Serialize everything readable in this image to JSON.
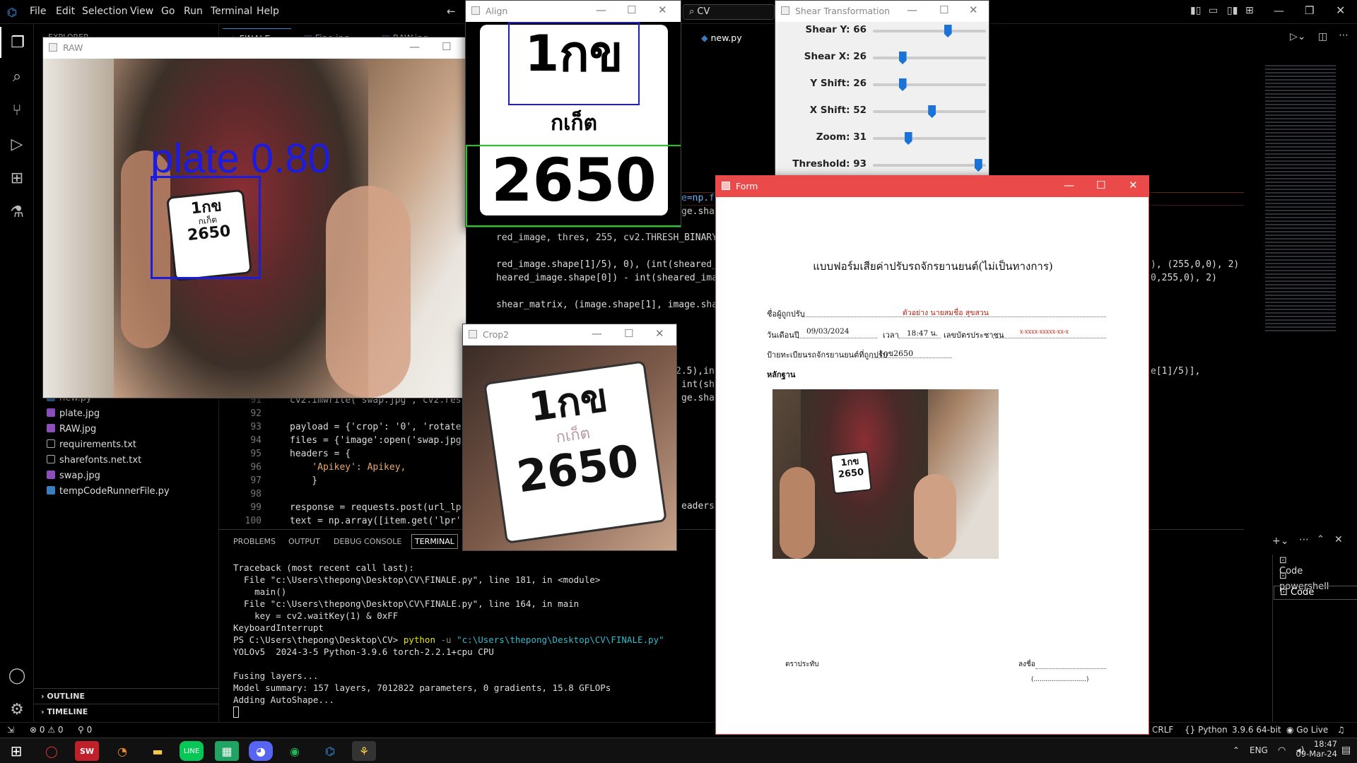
{
  "vscode": {
    "menu": [
      "File",
      "Edit",
      "Selection",
      "View",
      "Go",
      "Run",
      "Terminal",
      "Help"
    ],
    "search_text": "CV",
    "sidebar_title": "EXPLORER",
    "files": [
      "new.py",
      "plate.jpg",
      "RAW.jpg",
      "requirements.txt",
      "sharefonts.net.txt",
      "swap.jpg",
      "tempCodeRunnerFile.py"
    ],
    "outline_label": "OUTLINE",
    "timeline_label": "TIMELINE",
    "tabs": [
      "FINALE.py",
      "Fine.jpg",
      "RAW.jpg",
      "new.py"
    ],
    "line_numbers": [
      "91",
      "92",
      "93",
      "94",
      "95",
      "96",
      "97",
      "98",
      "99",
      "100"
    ],
    "code_lines": [
      "cv2.imwrite('swap.jpg', cv2.resi",
      "",
      "payload = {'crop': '0', 'rotate'",
      "files = {'image':open('swap.jpg'",
      "headers = {",
      "    'Apikey': Apikey,",
      "    }",
      "",
      "response = requests.post(url_lpr",
      "text = np.array([item.get('lpr')"
    ],
    "code_fragments": {
      "f1": "e=np.f",
      "f2": "ge.sha",
      "f3": "red_image, thres, 255, cv2.THRESH_BINARY)",
      "f4": "red_image.shape[1]/5), 0), (int(sheared_",
      "f5": "heared_image.shape[0]) - int(sheared_ima",
      "f6": "shear_matrix, (image.shape[1], image.sha",
      "f7": "2.5),in",
      "f8": "int(sh",
      "f9": "ge.sha",
      "f10": "eaders",
      "r1": "), (255,0,0), 2)",
      "r2": "0,255,0), 2)",
      "r3": "e[1]/5)],"
    },
    "panel_tabs": [
      "PROBLEMS",
      "OUTPUT",
      "DEBUG CONSOLE",
      "TERMINAL"
    ],
    "terminal_lines": [
      "Traceback (most recent call last):",
      "  File \"c:\\Users\\thepong\\Desktop\\CV\\FINALE.py\", line 181, in <module>",
      "    main()",
      "  File \"c:\\Users\\thepong\\Desktop\\CV\\FINALE.py\", line 164, in main",
      "    key = cv2.waitKey(1) & 0xFF",
      "KeyboardInterrupt",
      "PS C:\\Users\\thepong\\Desktop\\CV> ",
      "YOLOv5  2024-3-5 Python-3.9.6 torch-2.2.1+cpu CPU",
      "",
      "Fusing layers...",
      "Model summary: 157 layers, 7012822 parameters, 0 gradients, 15.8 GFLOPs",
      "Adding AutoShape..."
    ],
    "prompt_cmd": "python",
    "prompt_flag": " -u ",
    "prompt_path": "\"c:\\Users\\thepong\\Desktop\\CV\\FINALE.py\"",
    "terminal_instances": [
      "Code",
      "powershell",
      "Code"
    ],
    "status": {
      "errors": "0",
      "warnings": "0",
      "ports": "0",
      "eol": "CRLF",
      "lang": "Python",
      "version": "3.9.6 64-bit",
      "golive": "Go Live"
    }
  },
  "raw_window": {
    "title": "RAW",
    "detection_label": "plate 0.80",
    "plate_line1": "1กข",
    "plate_line2": "กเก็ต",
    "plate_line3": "2650"
  },
  "align_window": {
    "title": "Align",
    "line1": "1กข",
    "line2": "กเก็ต",
    "line3": "2650"
  },
  "crop_window": {
    "title": "Crop2",
    "line1": "1กข",
    "line2": "กเก็ต",
    "line3": "2650"
  },
  "shear_window": {
    "title": "Shear Transformation",
    "sliders": [
      {
        "label": "Shear Y: 66",
        "value": 66,
        "max": 100
      },
      {
        "label": "Shear X: 26",
        "value": 26,
        "max": 100
      },
      {
        "label": "Y Shift: 26",
        "value": 26,
        "max": 100
      },
      {
        "label": "X Shift: 52",
        "value": 52,
        "max": 100
      },
      {
        "label": "Zoom: 31",
        "value": 31,
        "max": 100
      },
      {
        "label": "Threshold: 93",
        "value": 93,
        "max": 100
      }
    ]
  },
  "form_window": {
    "title": "Form",
    "heading": "แบบฟอร์มเสียค่าปรับรถจักรยานยนต์(ไม่เป็นทางการ)",
    "name_label": "ชื่อผู้ถูกปรับ",
    "name_value": "ตัวอย่าง นายสมชื่อ สุขสวน",
    "date_label": "วันเดือนปี",
    "date_value": "09/03/2024",
    "time_label": "เวลา",
    "time_value": "18:47 น.",
    "id_label": "เลขบัตรประชาชน",
    "id_value": "x-xxxx-xxxxx-xx-x",
    "plate_label": "ป้ายทะเบียนรถจักรยานยนต์ที่ถูกปรับ",
    "plate_value": "1กข2650",
    "evidence_label": "หลักฐาน",
    "stamp_label": "ตราประทับ",
    "sign_label": "ลงชื่อ",
    "sign_paren": "(..........................)",
    "photo_plate1": "1กข",
    "photo_plate2": "2650"
  },
  "taskbar": {
    "lang": "ENG",
    "time": "18:47",
    "date": "09-Mar-24"
  }
}
